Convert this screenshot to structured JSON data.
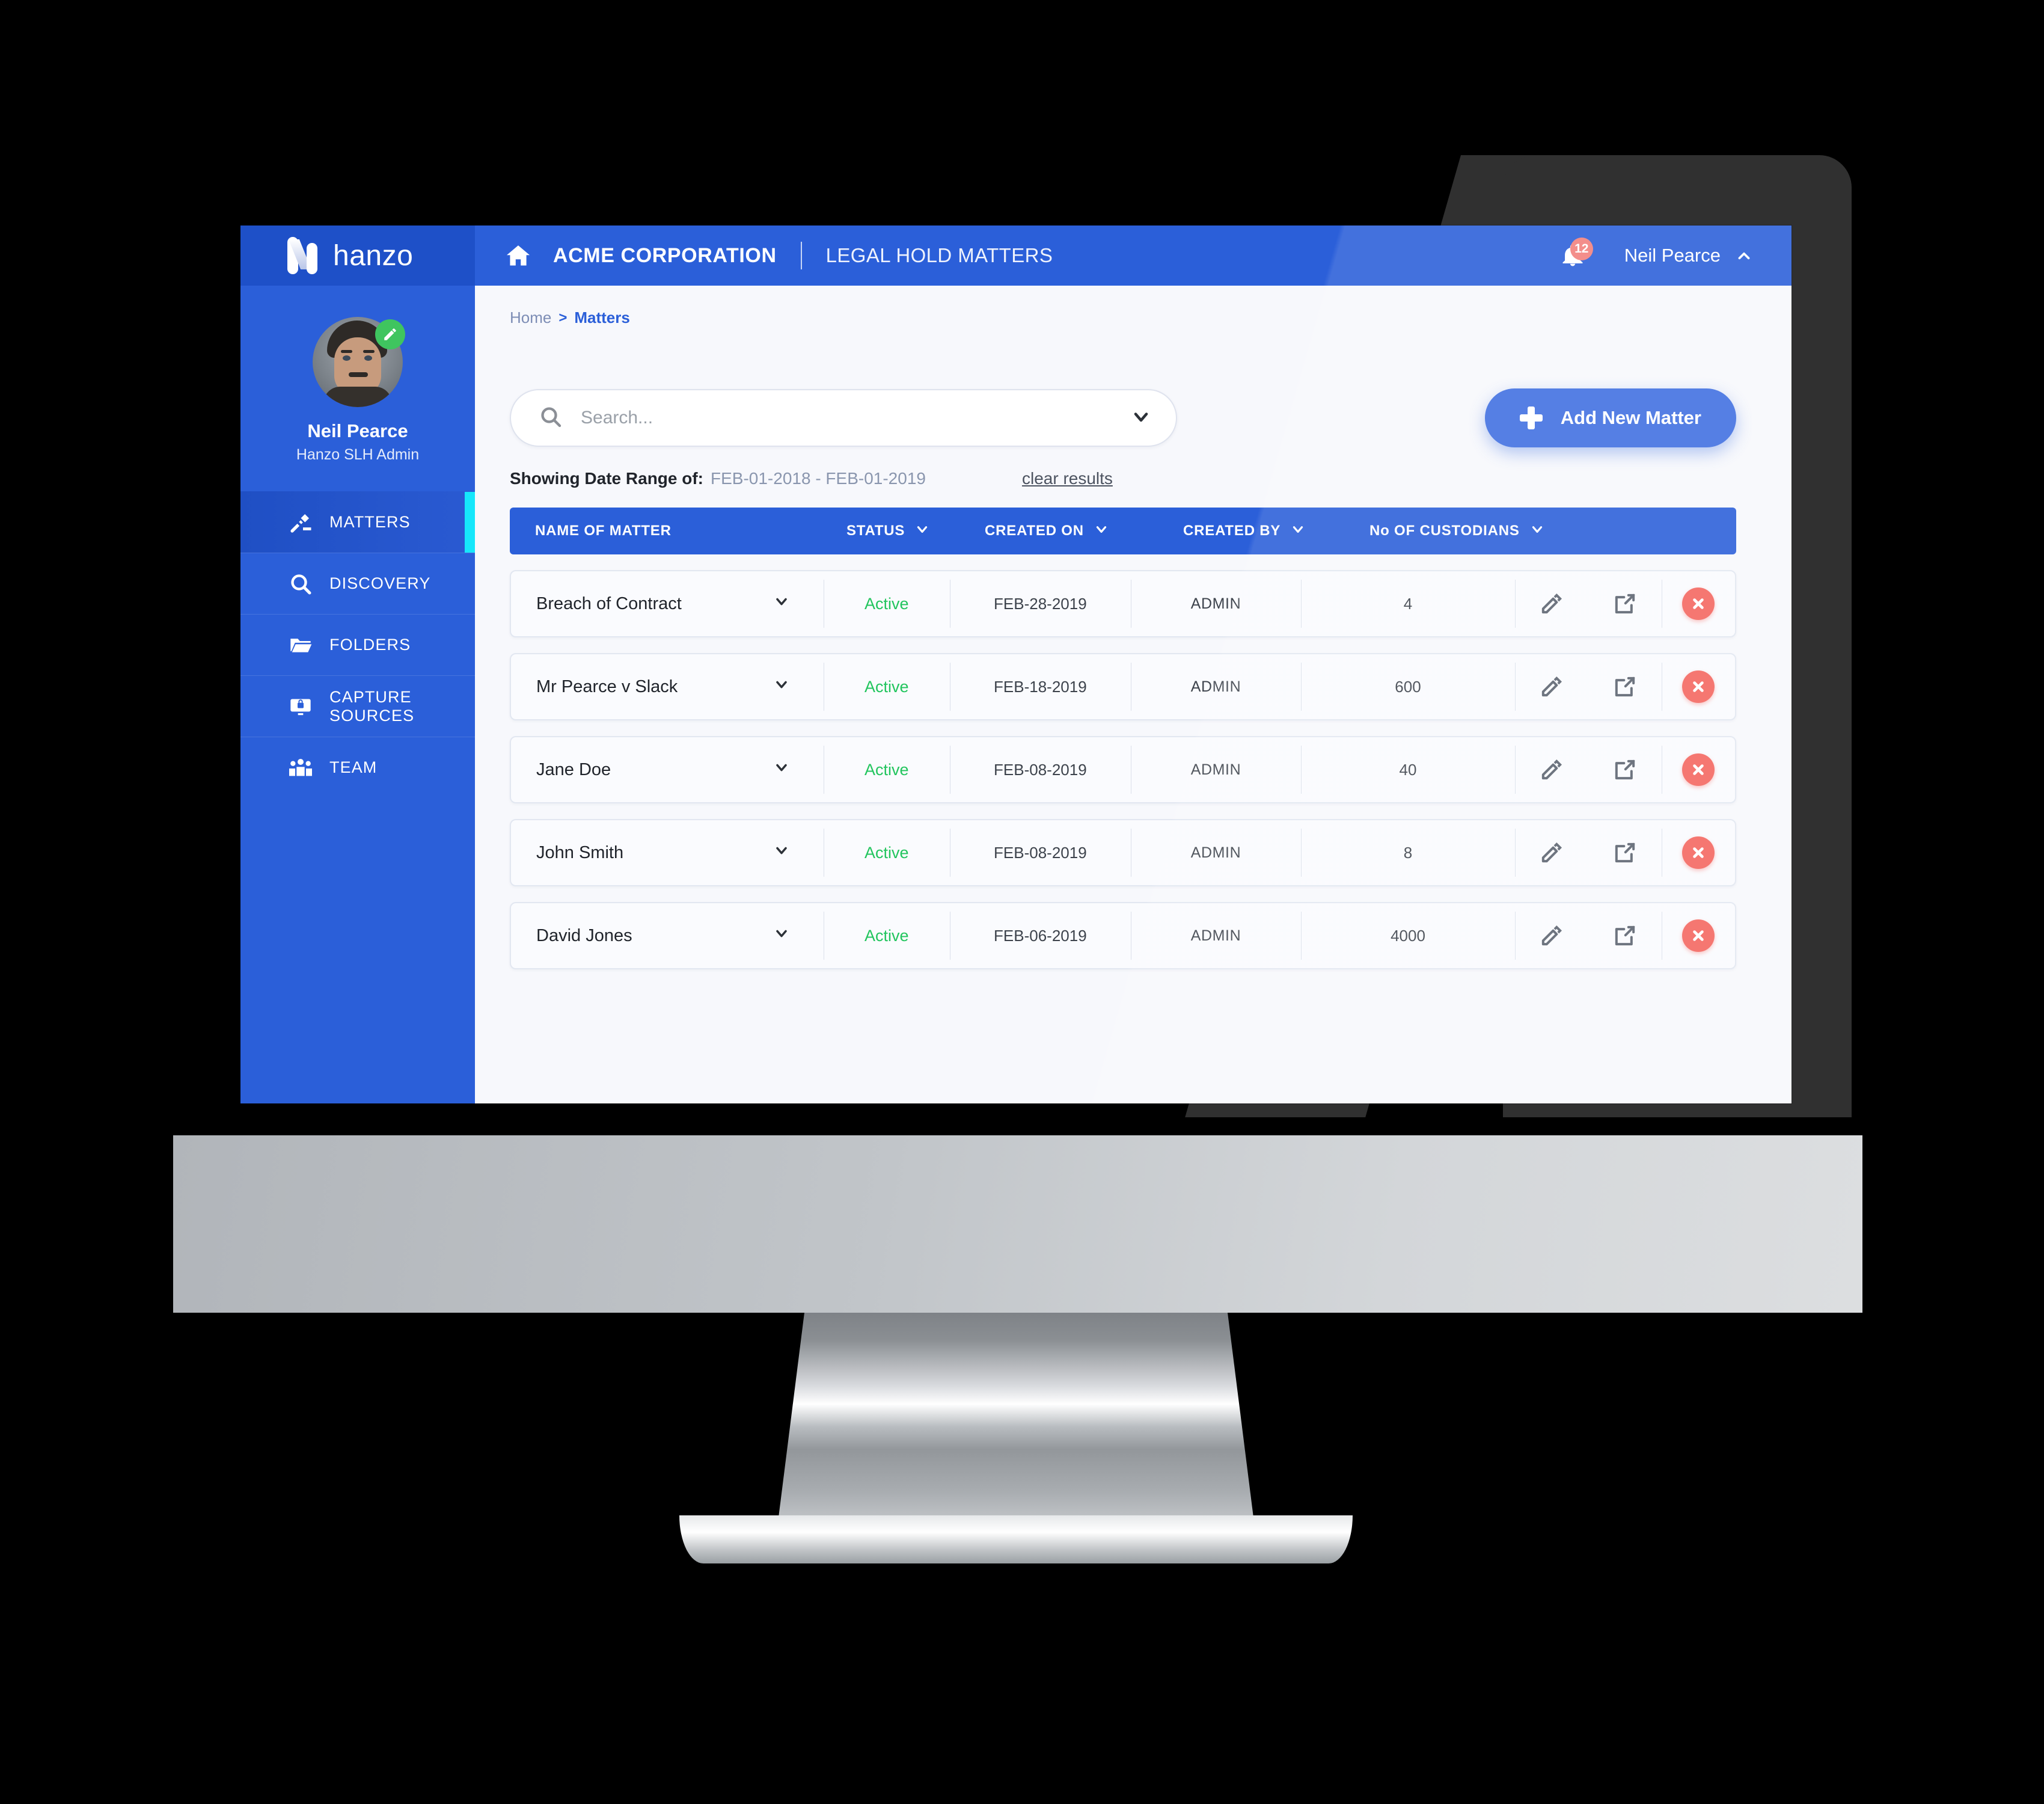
{
  "brand": {
    "logo_text": "hanzo",
    "accent_blue": "#2b5fd9",
    "accent_cyan": "#16e7fb"
  },
  "topbar": {
    "home_icon": "home-icon",
    "org_name": "ACME CORPORATION",
    "page_name": "LEGAL HOLD MATTERS",
    "bell_icon": "bell-icon",
    "notification_count": "12",
    "user_name": "Neil Pearce",
    "caret_icon": "chevron-up-icon"
  },
  "sidebar": {
    "profile": {
      "name": "Neil Pearce",
      "role": "Hanzo SLH Admin",
      "edit_icon": "pencil-icon",
      "avatar": "avatar"
    },
    "items": [
      {
        "label": "MATTERS",
        "icon": "gavel-icon",
        "active": true
      },
      {
        "label": "DISCOVERY",
        "icon": "search-icon",
        "active": false
      },
      {
        "label": "FOLDERS",
        "icon": "folder-icon",
        "active": false
      },
      {
        "label": "CAPTURE\nSOURCES",
        "icon": "monitor-lock-icon",
        "active": false
      },
      {
        "label": "TEAM",
        "icon": "people-icon",
        "active": false
      }
    ]
  },
  "breadcrumb": {
    "home": "Home",
    "separator": ">",
    "current": "Matters"
  },
  "search": {
    "placeholder": "Search...",
    "value": "",
    "icon": "search-icon",
    "caret_icon": "chevron-down-icon"
  },
  "add_button": {
    "label": "Add New Matter",
    "icon": "plus-icon"
  },
  "date_range": {
    "label": "Showing Date Range of:",
    "value": "FEB-01-2018 - FEB-01-2019",
    "clear_label": "clear results"
  },
  "table": {
    "columns": [
      {
        "label": "NAME OF MATTER",
        "sortable": false
      },
      {
        "label": "STATUS",
        "sortable": true
      },
      {
        "label": "CREATED ON",
        "sortable": true
      },
      {
        "label": "CREATED BY",
        "sortable": true
      },
      {
        "label": "No OF CUSTODIANS",
        "sortable": true
      }
    ],
    "row_actions": [
      {
        "name": "edit-icon",
        "label": "Edit"
      },
      {
        "name": "share-icon",
        "label": "Open"
      },
      {
        "name": "delete-icon",
        "label": "Delete"
      }
    ],
    "rows": [
      {
        "name": "Breach of Contract",
        "status": "Active",
        "created_on": "FEB-28-2019",
        "created_by": "ADMIN",
        "custodians": "4",
        "share_highlighted": false
      },
      {
        "name": "Mr Pearce v Slack",
        "status": "Active",
        "created_on": "FEB-18-2019",
        "created_by": "ADMIN",
        "custodians": "600",
        "share_highlighted": true
      },
      {
        "name": "Jane Doe",
        "status": "Active",
        "created_on": "FEB-08-2019",
        "created_by": "ADMIN",
        "custodians": "40",
        "share_highlighted": false
      },
      {
        "name": "John Smith",
        "status": "Active",
        "created_on": "FEB-08-2019",
        "created_by": "ADMIN",
        "custodians": "8",
        "share_highlighted": false
      },
      {
        "name": "David Jones",
        "status": "Active",
        "created_on": "FEB-06-2019",
        "created_by": "ADMIN",
        "custodians": "4000",
        "share_highlighted": false
      }
    ]
  }
}
